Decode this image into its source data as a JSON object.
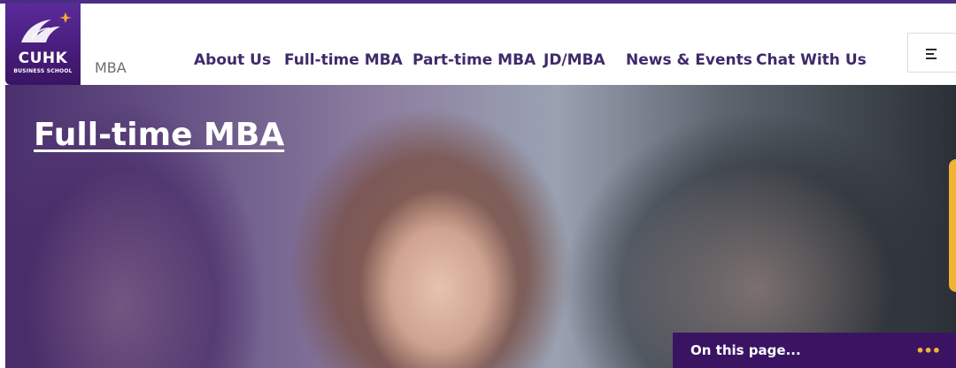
{
  "brand": {
    "logo_name": "CUHK",
    "logo_sub": "BUSINESS SCHOOL",
    "site_label": "MBA",
    "colors": {
      "primary": "#4b2e83",
      "accent": "#f2b233"
    }
  },
  "nav": {
    "items": [
      {
        "label": "About Us"
      },
      {
        "label": "Full-time MBA"
      },
      {
        "label": "Part-time MBA"
      },
      {
        "label": "JD/MBA"
      },
      {
        "label": "News & Events"
      },
      {
        "label": "Chat With Us"
      }
    ],
    "menu_icon": "hamburger-menu-icon"
  },
  "hero": {
    "title": "Full-time MBA"
  },
  "on_this_page": {
    "label": "On this page...",
    "more_icon": "ellipsis-icon",
    "more_glyph": "•••"
  }
}
